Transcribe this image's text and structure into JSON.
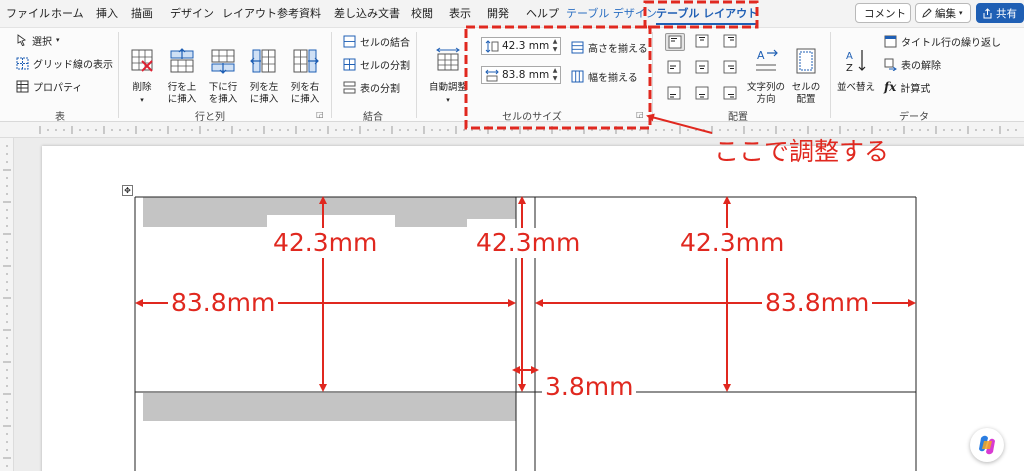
{
  "menu": {
    "tabs": [
      {
        "key": "file",
        "label": "ファイル"
      },
      {
        "key": "home",
        "label": "ホーム"
      },
      {
        "key": "insert",
        "label": "挿入"
      },
      {
        "key": "draw",
        "label": "描画"
      },
      {
        "key": "design",
        "label": "デザイン"
      },
      {
        "key": "layout",
        "label": "レイアウト"
      },
      {
        "key": "references",
        "label": "参考資料"
      },
      {
        "key": "mailings",
        "label": "差し込み文書"
      },
      {
        "key": "review",
        "label": "校閲"
      },
      {
        "key": "view",
        "label": "表示"
      },
      {
        "key": "developer",
        "label": "開発"
      },
      {
        "key": "help",
        "label": "ヘルプ"
      },
      {
        "key": "table-design",
        "label": "テーブル デザイン"
      },
      {
        "key": "table-layout",
        "label": "テーブル レイアウト"
      }
    ],
    "active_tab": "table-layout",
    "comment_label": "コメント",
    "edit_label": "編集",
    "share_label": "共有"
  },
  "ribbon": {
    "table_group": {
      "title": "表",
      "select": "選択",
      "gridlines": "グリッド線の表示",
      "properties": "プロパティ"
    },
    "rows_cols_group": {
      "title": "行と列",
      "delete": "削除",
      "insert_above": "行を上\nに挿入",
      "insert_below": "下に行\nを挿入",
      "insert_left": "列を左\nに挿入",
      "insert_right": "列を右\nに挿入"
    },
    "merge_group": {
      "title": "結合",
      "merge": "セルの結合",
      "split": "セルの分割",
      "split_table": "表の分割"
    },
    "cell_size_group": {
      "title": "セルのサイズ",
      "autofit": "自動調整",
      "height_value": "42.3 mm",
      "width_value": "83.8 mm",
      "distribute_rows": "高さを揃える",
      "distribute_cols": "幅を揃える"
    },
    "alignment_group": {
      "title": "配置",
      "text_direction": "文字列の\n方向",
      "cell_margins": "セルの\n配置"
    },
    "data_group": {
      "title": "データ",
      "sort": "並べ替え",
      "repeat_header": "タイトル行の繰り返し",
      "convert": "表の解除",
      "formula": "計算式"
    }
  },
  "annotations": {
    "note": "ここで調整する",
    "height_1": "42.3mm",
    "height_2": "42.3mm",
    "height_3": "42.3mm",
    "width_1": "83.8mm",
    "width_2": "83.8mm",
    "gap": "3.8mm"
  },
  "colors": {
    "accent": "#1f5fb4",
    "annotation": "#e0281f",
    "cell_shading": "#c4c4c4"
  }
}
